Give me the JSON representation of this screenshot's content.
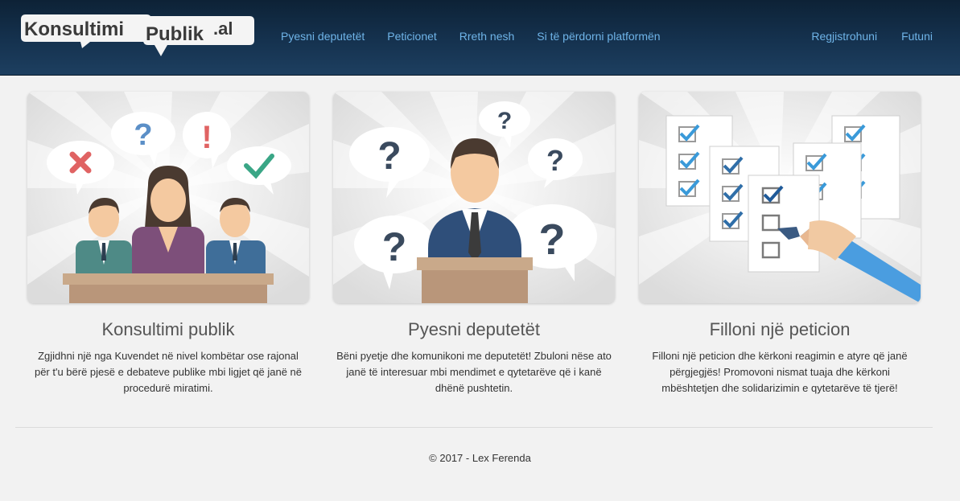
{
  "brand": {
    "logo_word1": "Konsultimi",
    "logo_word2": "Publik",
    "logo_tld": ".al"
  },
  "nav": {
    "items": [
      {
        "label": "Pyesni deputetët"
      },
      {
        "label": "Peticionet"
      },
      {
        "label": "Rreth nesh"
      },
      {
        "label": "Si të përdorni platformën"
      }
    ],
    "right": [
      {
        "label": "Regjistrohuni"
      },
      {
        "label": "Futuni"
      }
    ]
  },
  "cards": [
    {
      "title": "Konsultimi publik",
      "description": "Zgjidhni një nga Kuvendet në nivel kombëtar ose rajonal për t'u bërë pjesë e debateve publike mbi ligjet që janë në procedurë miratimi."
    },
    {
      "title": "Pyesni deputetët",
      "description": "Bëni pyetje dhe komunikoni me deputetët! Zbuloni nëse ato janë të interesuar mbi mendimet e qytetarëve që i kanë dhënë pushtetin."
    },
    {
      "title": "Filloni një peticion",
      "description": "Filloni një peticion dhe kërkoni reagimin e atyre që janë përgjegjës! Promovoni nismat tuaja dhe kërkoni mbështetjen dhe solidarizimin e qytetarëve të tjerë!"
    }
  ],
  "footer": {
    "copyright": "© 2017 - Lex Ferenda"
  },
  "colors": {
    "navbar_top": "#0d2236",
    "navbar_bottom": "#1d3f60",
    "nav_link": "#6fb4e8",
    "page_bg": "#f2f2f2",
    "accent_check": "#3a9ad9"
  }
}
